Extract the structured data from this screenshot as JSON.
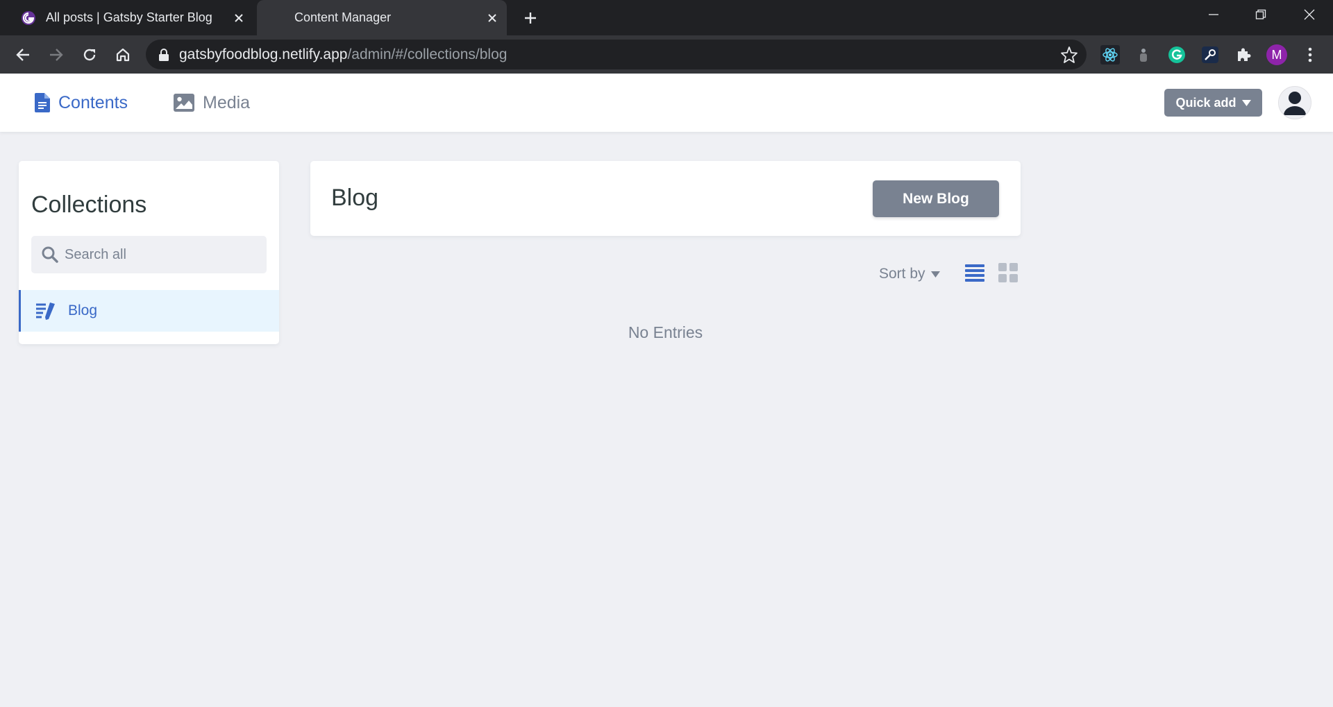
{
  "browser": {
    "tabs": [
      {
        "title": "All posts | Gatsby Starter Blog",
        "active": false
      },
      {
        "title": "Content Manager",
        "active": true
      }
    ],
    "url_host": "gatsbyfoodblog.netlify.app",
    "url_path": "/admin/#/collections/blog",
    "profile_initial": "M",
    "colors": {
      "tabbar": "#202124",
      "toolbar": "#35363a",
      "profile": "#8e24aa",
      "grammarly": "#15c39a"
    }
  },
  "header": {
    "contents_label": "Contents",
    "media_label": "Media",
    "quick_add_label": "Quick add",
    "colors": {
      "active": "#3a69c7",
      "inactive": "#798291"
    }
  },
  "sidebar": {
    "title": "Collections",
    "search_placeholder": "Search all",
    "items": [
      {
        "label": "Blog",
        "icon": "write-icon",
        "active": true
      }
    ]
  },
  "main": {
    "collection_title": "Blog",
    "new_button_label": "New Blog",
    "sort_by_label": "Sort by",
    "view_mode": "list",
    "empty_text": "No Entries"
  }
}
